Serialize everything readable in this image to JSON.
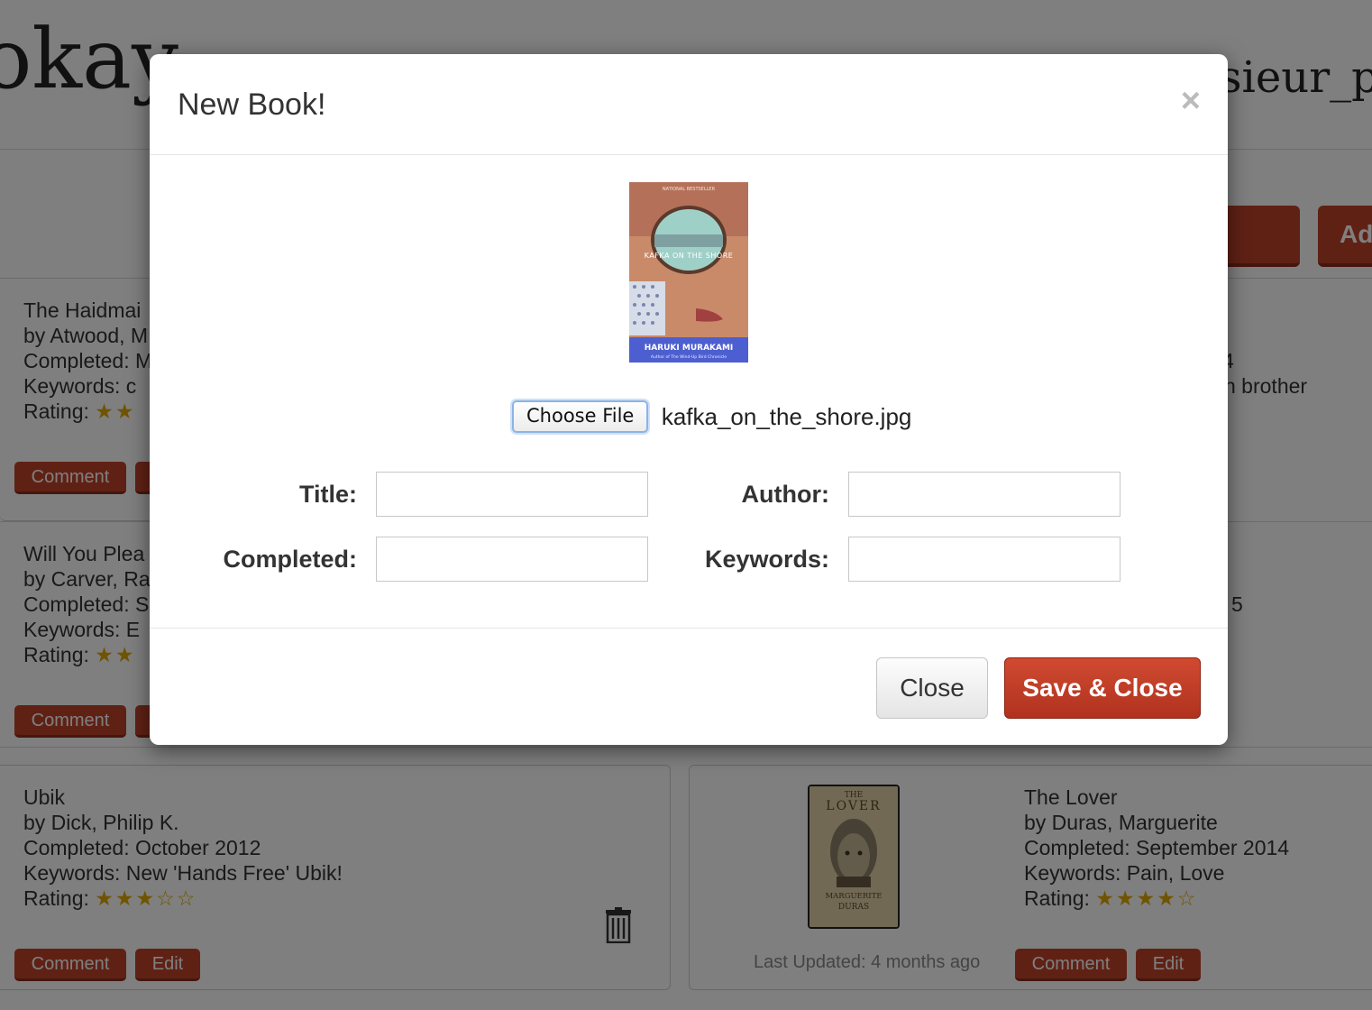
{
  "app": {
    "brand_partial": "okay",
    "username_partial": "nsieur_p"
  },
  "toolbar": {
    "add_button_partial": "Ad"
  },
  "books": [
    {
      "title": "The Haidmai",
      "author": "by Atwood, M",
      "completed": "Completed: M",
      "keywords": "Keywords:   c",
      "rating_label": "Rating:",
      "rating_stars": "★★",
      "right_fragment_1": "4",
      "right_fragment_2": "n brother",
      "comment_label": "Comment"
    },
    {
      "title": "Will You Plea",
      "author": "by Carver, Ra",
      "completed": "Completed: S",
      "keywords": "Keywords:   E",
      "rating_label": "Rating:",
      "rating_stars": "★★",
      "right_fragment_1": "5",
      "comment_label": "Comment"
    },
    {
      "title": "Ubik",
      "author": "by Dick, Philip K.",
      "completed": "Completed: October 2012",
      "keywords": "Keywords:   New 'Hands Free' Ubik!",
      "rating_label": "Rating:",
      "rating_filled": "★★★",
      "rating_empty": "☆☆",
      "rating": 3,
      "comment_label": "Comment",
      "edit_label": "Edit"
    },
    {
      "title": "The Lover",
      "author": "by Duras, Marguerite",
      "completed": "Completed: September 2014",
      "keywords": "Keywords:   Pain, Love",
      "rating_label": "Rating:",
      "rating_filled": "★★★★",
      "rating_empty": "☆",
      "rating": 4,
      "last_updated": "Last Updated: 4 months ago",
      "comment_label": "Comment",
      "edit_label": "Edit",
      "cover_lines": [
        "THE",
        "LOVER",
        "MARGUERITE",
        "DURAS"
      ]
    }
  ],
  "modal": {
    "title": "New Book!",
    "close_x": "×",
    "cover": {
      "top_text": "NATIONAL BESTSELLER",
      "title_text": "KAFKA ON THE SHORE",
      "author_text": "HARUKI MURAKAMI",
      "sub_text": "Author of The Wind-Up Bird Chronicle"
    },
    "choose_file_label": "Choose File",
    "file_name": "kafka_on_the_shore.jpg",
    "fields": {
      "title_label": "Title:",
      "author_label": "Author:",
      "completed_label": "Completed:",
      "keywords_label": "Keywords:",
      "title_value": "",
      "author_value": "",
      "completed_value": "",
      "keywords_value": ""
    },
    "close_button": "Close",
    "save_button": "Save & Close"
  },
  "colors": {
    "accent": "#c0432a",
    "star": "#e0a800"
  }
}
